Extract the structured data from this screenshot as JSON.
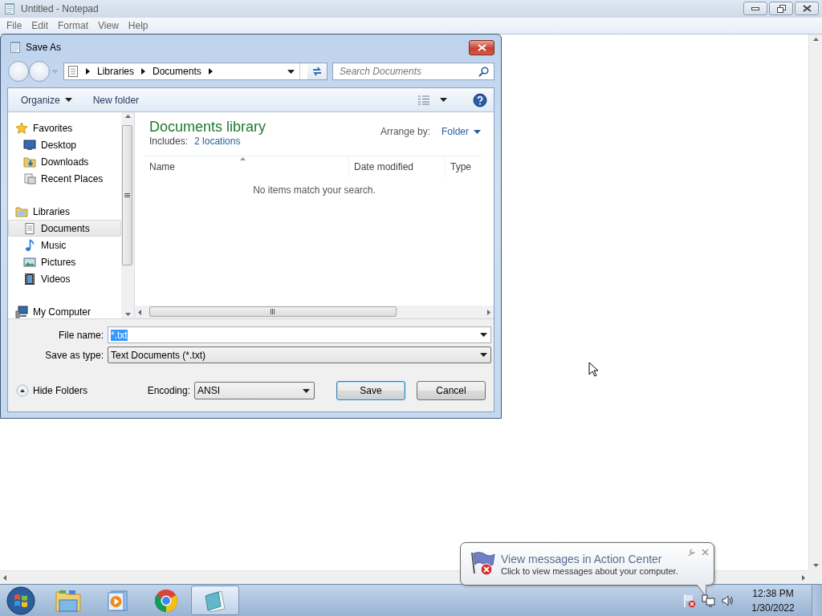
{
  "notepad": {
    "title": "Untitled - Notepad",
    "menu": [
      "File",
      "Edit",
      "Format",
      "View",
      "Help"
    ]
  },
  "save_dialog": {
    "title": "Save As",
    "breadcrumb": [
      "Libraries",
      "Documents"
    ],
    "search": {
      "placeholder": "Search Documents"
    },
    "toolbar": [
      {
        "label": "Organize",
        "dropdown": true
      },
      {
        "label": "New folder",
        "dropdown": false
      }
    ],
    "nav": [
      {
        "label": "Favorites",
        "kind": "favorites",
        "items": [
          {
            "label": "Desktop",
            "kind": "desktop",
            "selected": false
          },
          {
            "label": "Downloads",
            "kind": "downloads",
            "selected": false
          },
          {
            "label": "Recent Places",
            "kind": "recent",
            "selected": false
          }
        ]
      },
      {
        "label": "Libraries",
        "kind": "libraries",
        "items": [
          {
            "label": "Documents",
            "kind": "documents",
            "selected": true
          },
          {
            "label": "Music",
            "kind": "music",
            "selected": false
          },
          {
            "label": "Pictures",
            "kind": "pictures",
            "selected": false
          },
          {
            "label": "Videos",
            "kind": "videos",
            "selected": false
          }
        ]
      },
      {
        "label": "My Computer",
        "kind": "computer"
      }
    ],
    "library": {
      "title": "Documents library",
      "includes_label": "Includes:",
      "includes_link": "2 locations",
      "arrange_label": "Arrange by:",
      "arrange_value": "Folder"
    },
    "columns": [
      {
        "label": "Name",
        "sorted": true
      },
      {
        "label": "Date modified",
        "sorted": false
      },
      {
        "label": "Type",
        "sorted": false
      }
    ],
    "empty_message": "No items match your search.",
    "file_name": {
      "label": "File name:",
      "value": "*.txt"
    },
    "save_as_type": {
      "label": "Save as type:",
      "value": "Text Documents (*.txt)"
    },
    "hide_folders": "Hide Folders",
    "encoding": {
      "label": "Encoding:",
      "value": "ANSI"
    },
    "buttons": [
      {
        "label": "Save",
        "default": true
      },
      {
        "label": "Cancel",
        "default": false
      }
    ]
  },
  "balloon": {
    "title": "View messages in Action Center",
    "text": "Click to view messages about your computer."
  },
  "taskbar": {
    "apps": [
      {
        "kind": "explorer",
        "selected": false
      },
      {
        "kind": "media",
        "selected": false
      },
      {
        "kind": "browser",
        "selected": false
      },
      {
        "kind": "notepad",
        "selected": true
      }
    ],
    "clock": {
      "time": "12:38 PM",
      "date": "1/30/2022"
    }
  }
}
